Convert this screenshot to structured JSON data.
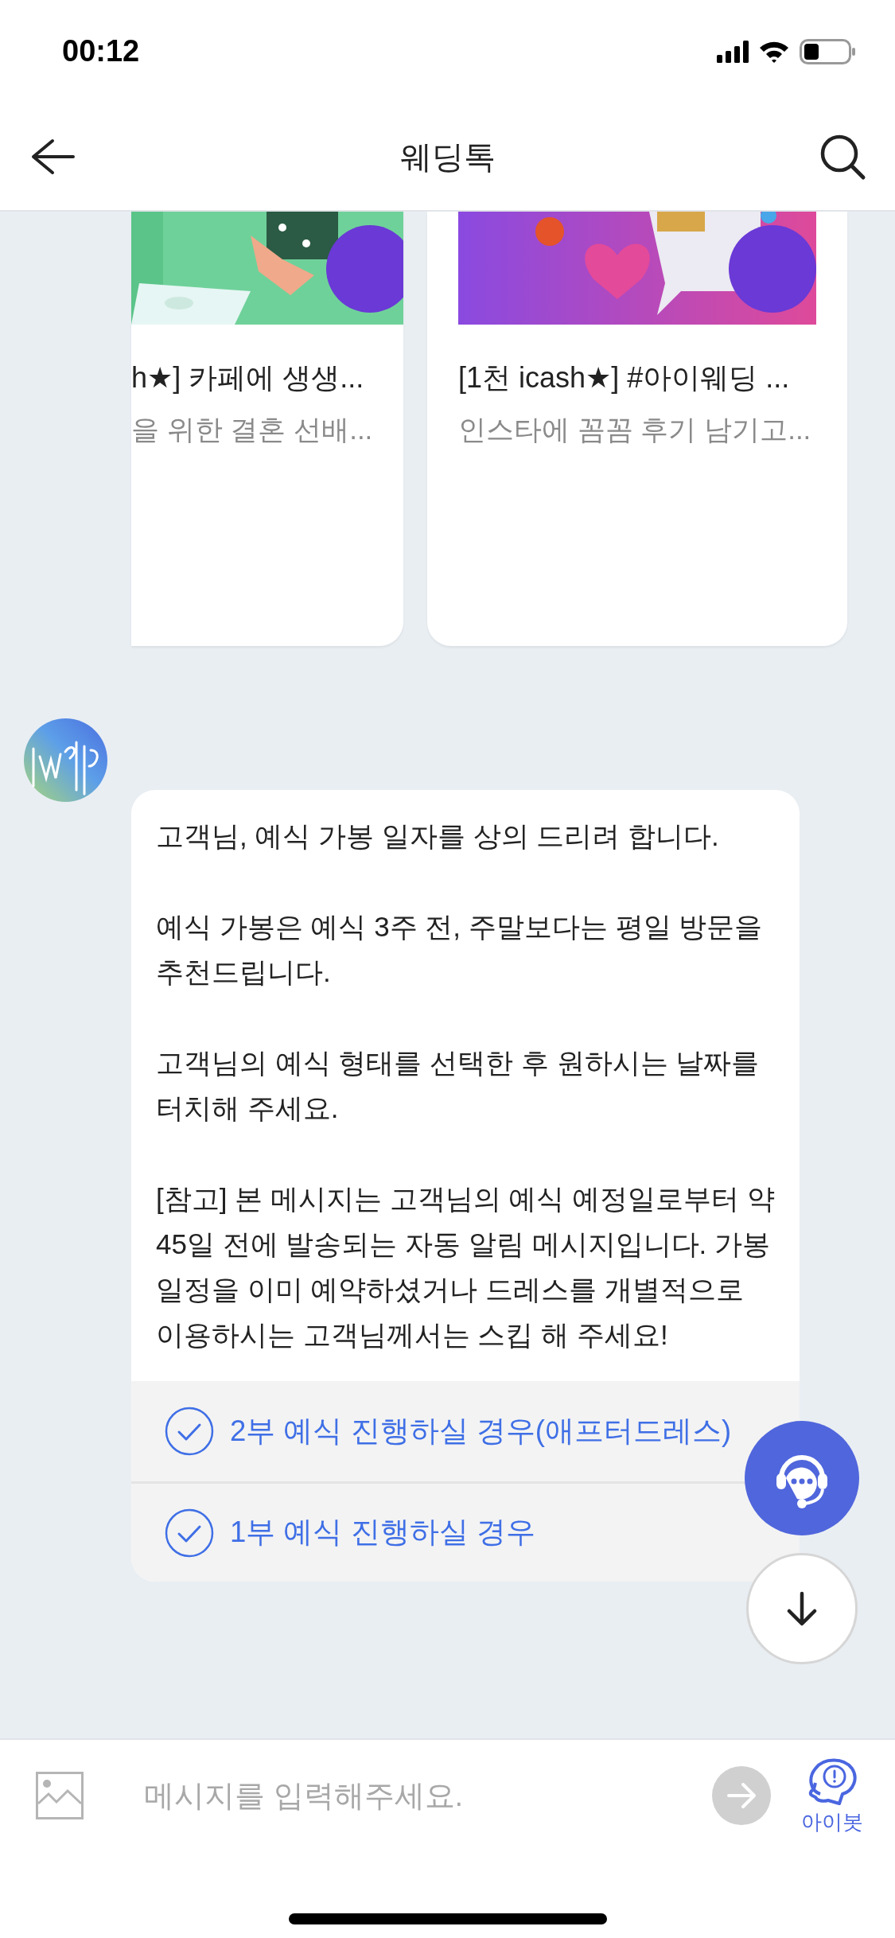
{
  "status_bar": {
    "time": "00:12"
  },
  "header": {
    "title": "웨딩톡"
  },
  "cards": [
    {
      "kind": "picture",
      "title": "h★] 카페에 생생...",
      "subtitle": "을 위한 결혼 선배..."
    },
    {
      "kind": "picture",
      "title": "[1천 icash★] #아이웨딩 ...",
      "subtitle": "인스타에 꼼꼼 후기 남기고..."
    }
  ],
  "message": {
    "paragraphs": [
      "고객님, 예식 가봉 일자를 상의 드리려 합니다.",
      "예식 가봉은 예식 3주 전, 주말보다는 평일 방문을 추천드립니다.",
      "고객님의 예식 형태를 선택한 후 원하시는 날짜를 터치해 주세요.",
      "[참고] 본 메시지는 고객님의 예식 예정일로부터 약 45일 전에 발송되는 자동 알림 메시지입니다. 가봉 일정을 이미 예약하셨거나 드레스를 개별적으로 이용하시는 고객님께서는 스킵 해 주세요!"
    ],
    "options": [
      {
        "label": "2부 예식 진행하실 경우(애프터드레스)"
      },
      {
        "label": "1부 예식 진행하실 경우"
      }
    ]
  },
  "composer": {
    "placeholder": "메시지를 입력해주세요.",
    "bot_label": "아이봇"
  }
}
